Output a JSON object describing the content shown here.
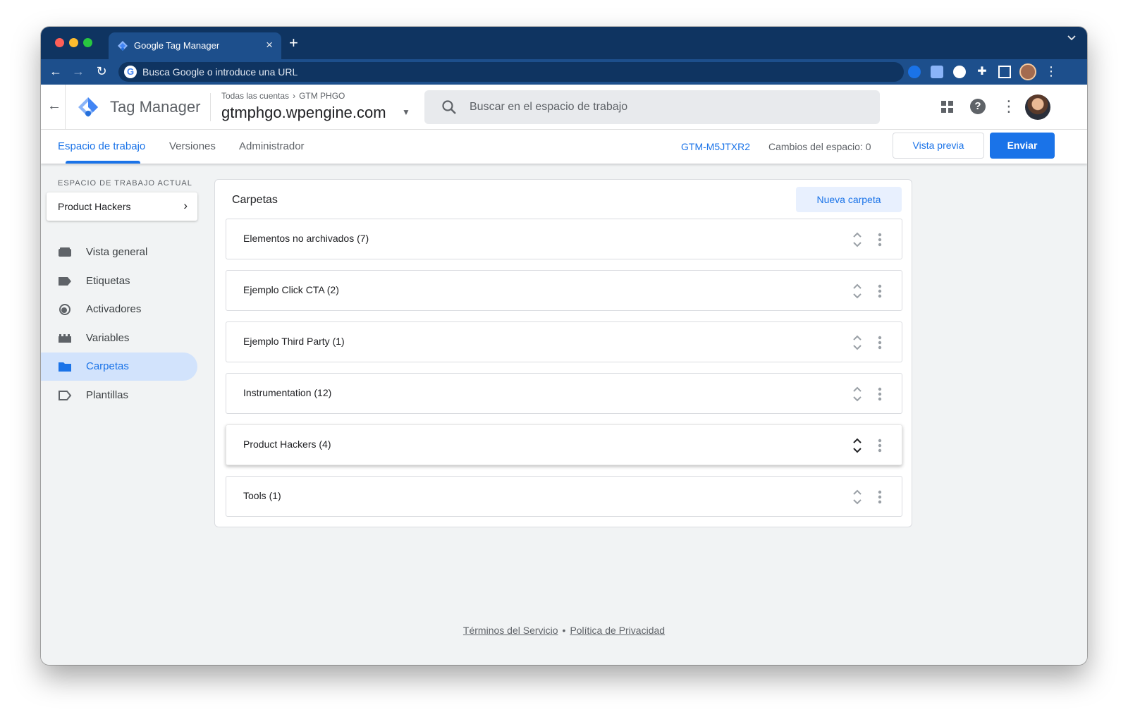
{
  "browser": {
    "tab_title": "Google Tag Manager",
    "tab_close": "×",
    "new_tab": "+",
    "omnibox_placeholder": "Busca Google o introduce una URL",
    "omnibox_badge": "G"
  },
  "header": {
    "product_name": "Tag Manager",
    "breadcrumb": {
      "accounts": "Todas las cuentas",
      "account": "GTM PHGO"
    },
    "container_name": "gtmphgo.wpengine.com",
    "search_placeholder": "Buscar en el espacio de trabajo",
    "help_glyph": "?"
  },
  "subnav": {
    "tabs": [
      "Espacio de trabajo",
      "Versiones",
      "Administrador"
    ],
    "active_tab": "Espacio de trabajo",
    "container_id": "GTM-M5JTXR2",
    "workspace_changes_label": "Cambios del espacio:",
    "workspace_changes_count": "0",
    "preview_label": "Vista previa",
    "submit_label": "Enviar"
  },
  "sidebar": {
    "current_workspace_label": "ESPACIO DE TRABAJO ACTUAL",
    "current_workspace": "Product Hackers",
    "items": [
      {
        "label": "Vista general",
        "icon": "overview-icon",
        "active": false
      },
      {
        "label": "Etiquetas",
        "icon": "tag-icon",
        "active": false
      },
      {
        "label": "Activadores",
        "icon": "trigger-icon",
        "active": false
      },
      {
        "label": "Variables",
        "icon": "variables-icon",
        "active": false
      },
      {
        "label": "Carpetas",
        "icon": "folder-icon",
        "active": true
      },
      {
        "label": "Plantillas",
        "icon": "template-icon",
        "active": false
      }
    ]
  },
  "main": {
    "title": "Carpetas",
    "new_folder_label": "Nueva carpeta",
    "folders": [
      {
        "name": "Elementos no archivados (7)",
        "raised": false
      },
      {
        "name": "Ejemplo Click CTA (2)",
        "raised": false
      },
      {
        "name": "Ejemplo Third Party (1)",
        "raised": false
      },
      {
        "name": "Instrumentation (12)",
        "raised": false
      },
      {
        "name": "Product Hackers (4)",
        "raised": true
      },
      {
        "name": "Tools (1)",
        "raised": false
      }
    ]
  },
  "footer": {
    "terms": "Términos del Servicio",
    "separator": "•",
    "privacy": "Política de Privacidad"
  },
  "colors": {
    "accent": "#1a73e8",
    "browser_frame": "#0f3461",
    "browser_toolbar": "#1d4f8c",
    "active_nav_bg": "#d2e3fc"
  }
}
